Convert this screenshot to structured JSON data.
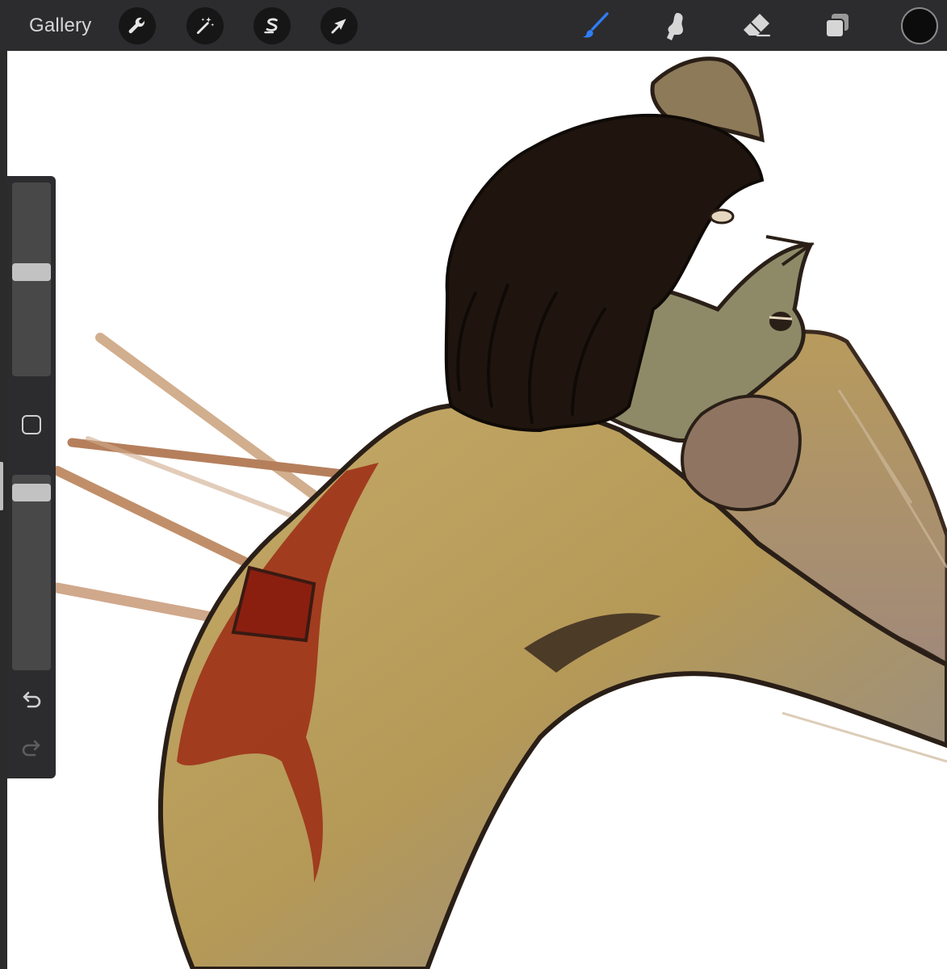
{
  "app": {
    "gallery_label": "Gallery",
    "accent_color": "#2f7df6",
    "toolbar_color": "#2c2c2e"
  },
  "toolbar": {
    "left_tools": [
      {
        "name": "actions",
        "icon": "wrench-icon"
      },
      {
        "name": "adjustments",
        "icon": "magic-wand-icon"
      },
      {
        "name": "selection",
        "icon": "selection-s-icon"
      },
      {
        "name": "transform",
        "icon": "arrow-cursor-icon"
      }
    ],
    "right_tools": [
      {
        "name": "brush",
        "icon": "paintbrush-icon",
        "active": true
      },
      {
        "name": "smudge",
        "icon": "smudge-finger-icon",
        "active": false
      },
      {
        "name": "eraser",
        "icon": "eraser-icon",
        "active": false
      },
      {
        "name": "layers",
        "icon": "layers-icon",
        "active": false
      }
    ],
    "current_color": "#0c0c0c"
  },
  "sidebar": {
    "brush_size_level": 0.54,
    "brush_opacity_level": 0.95,
    "modify_icon": "square-modify-icon",
    "undo_icon": "undo-arrow-icon",
    "redo_icon": "redo-arrow-icon",
    "redo_enabled": false
  },
  "canvas": {
    "background": "#ffffff",
    "artwork": "figure-with-arrows-illustration"
  }
}
